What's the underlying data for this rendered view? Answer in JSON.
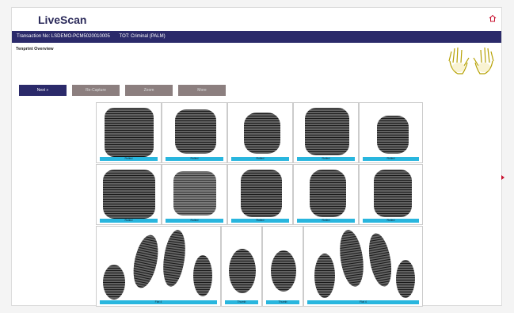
{
  "app": {
    "title": "LiveScan"
  },
  "infobar": {
    "transaction": "Transaction No: LSDEMO-PCM5020010005",
    "tot": "TOT: Criminal (PALM)"
  },
  "section": {
    "title": "Tenprint Overview"
  },
  "toolbar": {
    "next_label": "Next »",
    "recapture_label": "Re-Capture",
    "zoom_label": "Zoom",
    "more_label": "More"
  },
  "prints": {
    "row1": [
      "Rolled",
      "Rolled",
      "Rolled",
      "Rolled",
      "Rolled"
    ],
    "row2": [
      "Rolled",
      "Rolled",
      "Rolled",
      "Rolled",
      "Rolled"
    ],
    "row3": [
      "Flat 4",
      "Thumb",
      "Thumb",
      "Flat 4"
    ]
  },
  "colors": {
    "accent": "#2b2a6a",
    "label_bar": "#29b6de",
    "disabled_button": "#8c7f7f"
  }
}
